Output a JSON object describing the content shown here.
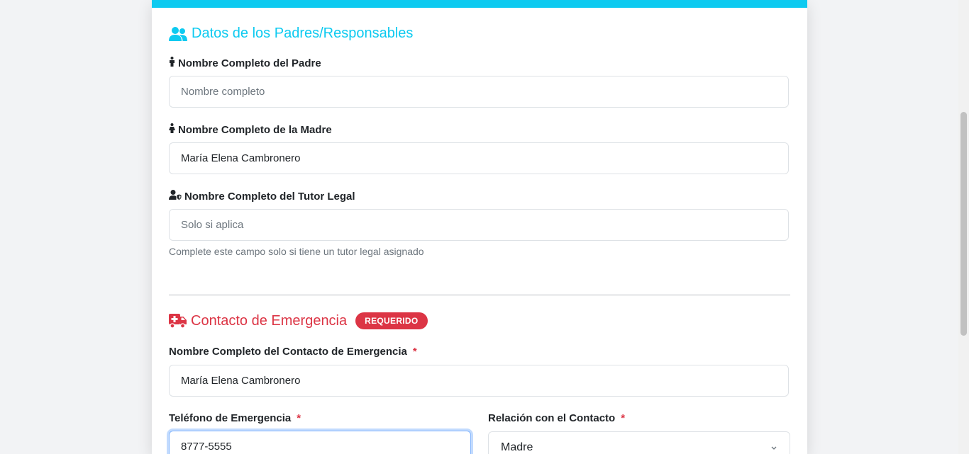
{
  "colors": {
    "info": "#0dcaf0",
    "danger": "#dc3545",
    "label": "#212529",
    "muted": "#6c757d"
  },
  "parents_section": {
    "title": "Datos de los Padres/Responsables",
    "icon": "users-icon",
    "father": {
      "label": "Nombre Completo del Padre",
      "icon": "male-icon",
      "value": "",
      "placeholder": "Nombre completo"
    },
    "mother": {
      "label": "Nombre Completo de la Madre",
      "icon": "female-icon",
      "value": "María Elena Cambronero",
      "placeholder": ""
    },
    "tutor": {
      "label": "Nombre Completo del Tutor Legal",
      "icon": "user-shield-icon",
      "value": "",
      "placeholder": "Solo si aplica",
      "hint": "Complete este campo solo si tiene un tutor legal asignado"
    }
  },
  "emergency_section": {
    "title": "Contacto de Emergencia",
    "icon": "ambulance-icon",
    "badge": "REQUERIDO",
    "contact_name": {
      "label": "Nombre Completo del Contacto de Emergencia",
      "required_mark": "*",
      "value": "María Elena Cambronero"
    },
    "phone": {
      "label": "Teléfono de Emergencia",
      "required_mark": "*",
      "value": "8777-5555"
    },
    "relation": {
      "label": "Relación con el Contacto",
      "required_mark": "*",
      "selected": "Madre",
      "icon": "chevron-down-icon"
    }
  }
}
